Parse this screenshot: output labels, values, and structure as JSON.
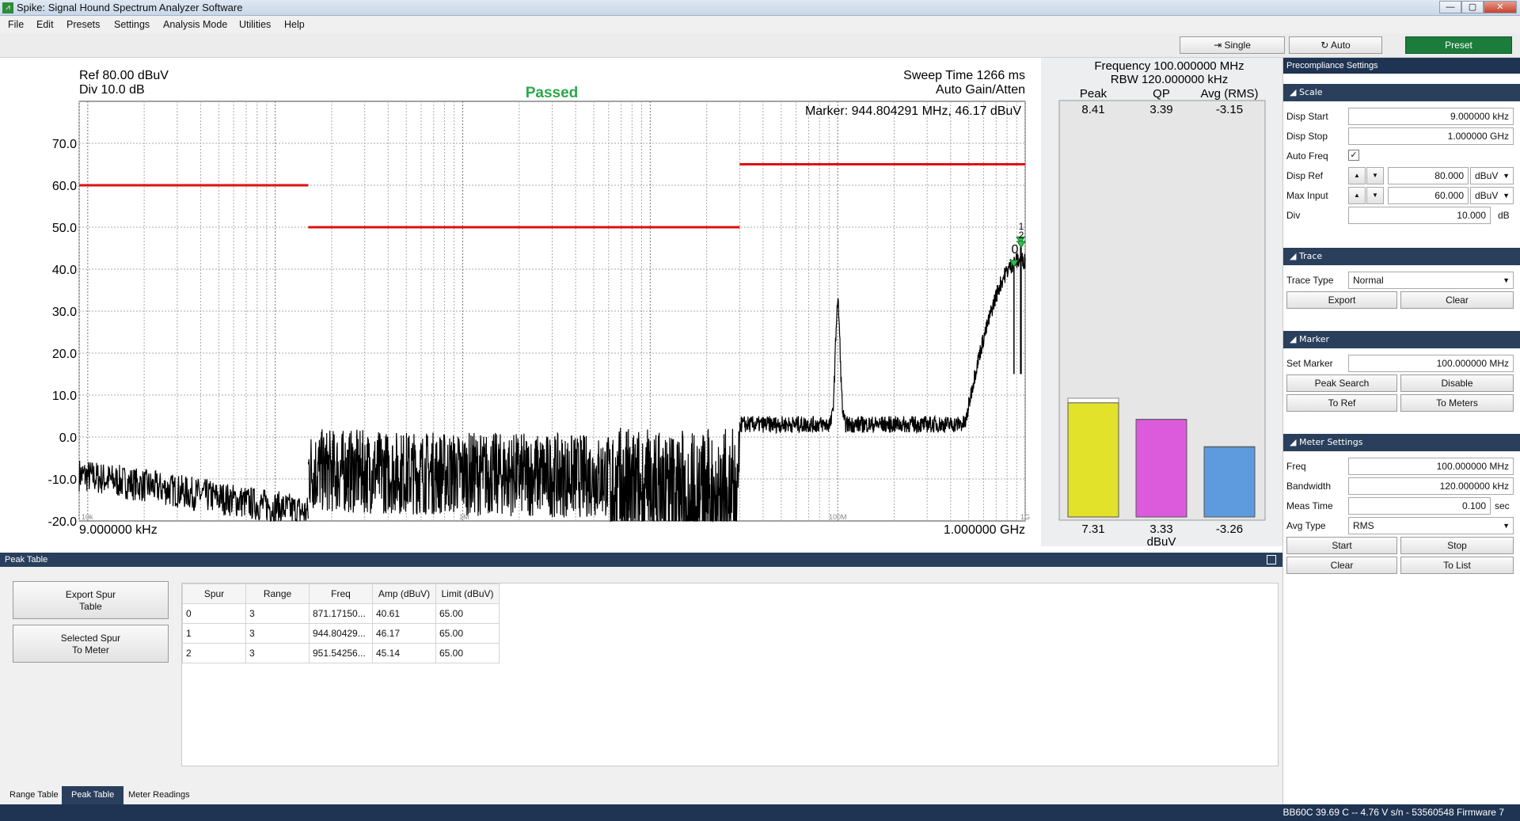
{
  "window": {
    "title": "Spike: Signal Hound Spectrum Analyzer Software",
    "min": "—",
    "max": "▢",
    "close": "✕"
  },
  "menu": [
    "File",
    "Edit",
    "Presets",
    "Settings",
    "Analysis Mode",
    "Utilities",
    "Help"
  ],
  "toolbar": {
    "single": "Single",
    "auto": "Auto",
    "preset": "Preset"
  },
  "plot": {
    "ref": "Ref 80.00 dBuV",
    "div": "Div 10.0 dB",
    "status": "Passed",
    "sweep_time": "Sweep Time 1266 ms",
    "gain": "Auto Gain/Atten",
    "marker": "Marker: 944.804291 MHz, 46.17 dBuV",
    "start": "9.000000 kHz",
    "stop": "1.000000 GHz",
    "marker_labels": [
      "0",
      "1",
      "2"
    ],
    "decade_labels": [
      "10k",
      "1M",
      "100M",
      "1G"
    ]
  },
  "chart_data": {
    "type": "line",
    "x_scale": "log",
    "xlim_hz": [
      9000,
      1000000000
    ],
    "ylim": [
      -20,
      80
    ],
    "y_ticks": [
      "70.0",
      "60.0",
      "50.0",
      "40.0",
      "30.0",
      "20.0",
      "10.0",
      "0.0",
      "-10.0",
      "-20.0"
    ],
    "limit_lines": [
      {
        "from_hz": 9000,
        "to_hz": 150000,
        "level": 60
      },
      {
        "from_hz": 150000,
        "to_hz": 30000000,
        "level": 50
      },
      {
        "from_hz": 30000000,
        "to_hz": 1000000000,
        "level": 65
      }
    ],
    "trace": {
      "segments": [
        {
          "from_hz": 9000,
          "to_hz": 150000,
          "level_start": -9,
          "level_end": -18,
          "noise": 4
        },
        {
          "from_hz": 150000,
          "to_hz": 30000000,
          "level_start": -8,
          "level_end": -10,
          "noise": 10
        },
        {
          "from_hz": 30000000,
          "to_hz": 1000000000,
          "level_start": 2,
          "level_end": 30,
          "noise": 2
        }
      ],
      "peaks": [
        {
          "freq_hz": 100000000,
          "level": 32
        },
        {
          "freq_hz": 871171500,
          "level": 40.61
        },
        {
          "freq_hz": 944804291,
          "level": 46.17
        },
        {
          "freq_hz": 951542560,
          "level": 45.14
        }
      ]
    },
    "grid": true,
    "line_color": "#000000",
    "limit_color": "#dd1111"
  },
  "meter": {
    "frequency": "Frequency 100.000000 MHz",
    "rbw": "RBW 120.000000 kHz",
    "headers": [
      "Peak",
      "QP",
      "Avg (RMS)"
    ],
    "top_values": [
      "8.41",
      "3.39",
      "-3.15"
    ],
    "bottom_values": [
      "7.31",
      "3.33",
      "-3.26"
    ],
    "unit": "dBuV",
    "bars": [
      {
        "name": "Peak",
        "value": 7.31,
        "max": 8.41,
        "color": "#e2e22a"
      },
      {
        "name": "QP",
        "value": 3.33,
        "max": 3.39,
        "color": "#dc5bdc"
      },
      {
        "name": "Avg (RMS)",
        "value": -3.26,
        "max": -3.15,
        "color": "#5e9bde"
      }
    ]
  },
  "side": {
    "title": "Precompliance Settings",
    "scale": {
      "header": "Scale",
      "disp_start_label": "Disp Start",
      "disp_start": "9.000000 kHz",
      "disp_stop_label": "Disp Stop",
      "disp_stop": "1.000000 GHz",
      "auto_freq_label": "Auto Freq",
      "auto_freq_check": "✓",
      "disp_ref_label": "Disp Ref",
      "disp_ref": "80.000",
      "disp_ref_unit": "dBuV",
      "max_input_label": "Max Input",
      "max_input": "60.000",
      "max_input_unit": "dBuV",
      "div_label": "Div",
      "div": "10.000",
      "div_unit": "dB",
      "up": "▲",
      "down": "▼"
    },
    "trace": {
      "header": "Trace",
      "type_label": "Trace Type",
      "type": "Normal",
      "export": "Export",
      "clear": "Clear"
    },
    "marker": {
      "header": "Marker",
      "set_label": "Set Marker",
      "set": "100.000000 MHz",
      "peak_search": "Peak Search",
      "disable": "Disable",
      "to_ref": "To Ref",
      "to_meters": "To Meters"
    },
    "meter_settings": {
      "header": "Meter Settings",
      "freq_label": "Freq",
      "freq": "100.000000 MHz",
      "bw_label": "Bandwidth",
      "bw": "120.000000 kHz",
      "meas_label": "Meas Time",
      "meas": "0.100",
      "meas_unit": "sec",
      "avg_label": "Avg Type",
      "avg": "RMS",
      "start": "Start",
      "stop": "Stop",
      "clear": "Clear",
      "to_list": "To List"
    }
  },
  "peak_table": {
    "title": "Peak Table",
    "export_btn": [
      "Export Spur",
      "Table"
    ],
    "selected_btn": [
      "Selected Spur",
      "To Meter"
    ],
    "columns": [
      "Spur",
      "Range",
      "Freq",
      "Amp (dBuV)",
      "Limit (dBuV)"
    ],
    "rows": [
      [
        "0",
        "3",
        "871.17150...",
        "40.61",
        "65.00"
      ],
      [
        "1",
        "3",
        "944.80429...",
        "46.17",
        "65.00"
      ],
      [
        "2",
        "3",
        "951.54256...",
        "45.14",
        "65.00"
      ]
    ]
  },
  "tabs": [
    "Range Table",
    "Peak Table",
    "Meter Readings"
  ],
  "active_tab": "Peak Table",
  "status": "BB60C   39.69 C  -- 4.76 V  s/n - 53560548   Firmware 7"
}
